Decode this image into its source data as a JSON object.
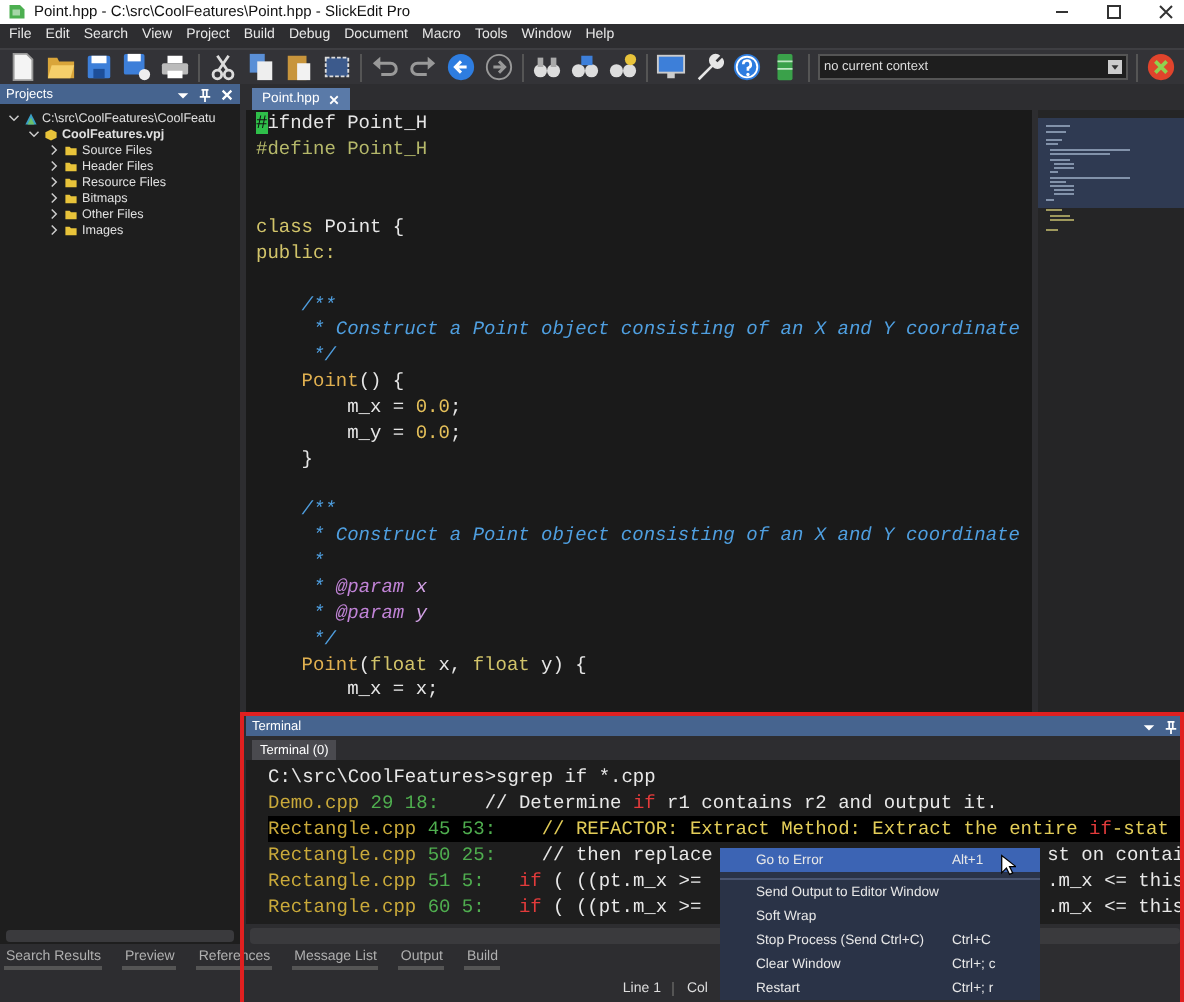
{
  "window": {
    "title": "Point.hpp - C:\\src\\CoolFeatures\\Point.hpp - SlickEdit Pro"
  },
  "menu": [
    "File",
    "Edit",
    "Search",
    "View",
    "Project",
    "Build",
    "Debug",
    "Document",
    "Macro",
    "Tools",
    "Window",
    "Help"
  ],
  "toolbar": {
    "context": {
      "value": "no current context"
    }
  },
  "projects": {
    "title": "Projects",
    "tree": [
      {
        "label": "C:\\src\\CoolFeatures\\CoolFeatu",
        "kind": "workspace",
        "expanded": true,
        "children": [
          {
            "label": "CoolFeatures.vpj",
            "kind": "project",
            "expanded": true,
            "children": [
              {
                "label": "Source Files",
                "kind": "folder",
                "expanded": false
              },
              {
                "label": "Header Files",
                "kind": "folder",
                "expanded": false
              },
              {
                "label": "Resource Files",
                "kind": "folder",
                "expanded": false
              },
              {
                "label": "Bitmaps",
                "kind": "folder",
                "expanded": false
              },
              {
                "label": "Other Files",
                "kind": "folder",
                "expanded": false
              },
              {
                "label": "Images",
                "kind": "folder",
                "expanded": false
              }
            ]
          }
        ]
      }
    ]
  },
  "editor": {
    "tabs": [
      {
        "label": "Point.hpp",
        "selected": true
      }
    ],
    "lines": [
      {
        "kind": "code",
        "segments": [
          {
            "text": "#",
            "kind": "cursor"
          },
          {
            "text": "ifndef Point_H",
            "kind": "plain"
          }
        ]
      },
      {
        "kind": "code",
        "segments": [
          {
            "text": "#define Point_H",
            "kind": "pre"
          }
        ]
      },
      {
        "kind": "blank"
      },
      {
        "kind": "blank"
      },
      {
        "kind": "code",
        "segments": [
          {
            "text": "class",
            "kind": "keyword"
          },
          {
            "text": " Point {",
            "kind": "plain"
          }
        ]
      },
      {
        "kind": "code",
        "segments": [
          {
            "text": "public:",
            "kind": "keyword"
          }
        ]
      },
      {
        "kind": "blank"
      },
      {
        "kind": "code",
        "segments": [
          {
            "text": "    /**",
            "kind": "comment"
          }
        ]
      },
      {
        "kind": "code",
        "segments": [
          {
            "text": "     * Construct a Point object consisting of an X and Y coordinate",
            "kind": "comment"
          }
        ]
      },
      {
        "kind": "code",
        "segments": [
          {
            "text": "     */",
            "kind": "comment"
          }
        ]
      },
      {
        "kind": "code",
        "segments": [
          {
            "text": "    Point",
            "kind": "func"
          },
          {
            "text": "() {",
            "kind": "plain"
          }
        ]
      },
      {
        "kind": "code",
        "segments": [
          {
            "text": "        m_x = ",
            "kind": "plain"
          },
          {
            "text": "0.0",
            "kind": "number"
          },
          {
            "text": ";",
            "kind": "plain"
          }
        ]
      },
      {
        "kind": "code",
        "segments": [
          {
            "text": "        m_y = ",
            "kind": "plain"
          },
          {
            "text": "0.0",
            "kind": "number"
          },
          {
            "text": ";",
            "kind": "plain"
          }
        ]
      },
      {
        "kind": "code",
        "segments": [
          {
            "text": "    }",
            "kind": "plain"
          }
        ]
      },
      {
        "kind": "blank"
      },
      {
        "kind": "code",
        "segments": [
          {
            "text": "    /**",
            "kind": "comment"
          }
        ]
      },
      {
        "kind": "code",
        "segments": [
          {
            "text": "     * Construct a Point object consisting of an X and Y coordinate",
            "kind": "comment"
          }
        ]
      },
      {
        "kind": "code",
        "segments": [
          {
            "text": "     *",
            "kind": "comment"
          }
        ]
      },
      {
        "kind": "code",
        "segments": [
          {
            "text": "     * ",
            "kind": "comment"
          },
          {
            "text": "@param",
            "kind": "doc"
          },
          {
            "text": " x",
            "kind": "docarg"
          }
        ]
      },
      {
        "kind": "code",
        "segments": [
          {
            "text": "     * ",
            "kind": "comment"
          },
          {
            "text": "@param",
            "kind": "doc"
          },
          {
            "text": " y",
            "kind": "docarg"
          }
        ]
      },
      {
        "kind": "code",
        "segments": [
          {
            "text": "     */",
            "kind": "comment"
          }
        ]
      },
      {
        "kind": "code",
        "segments": [
          {
            "text": "    Point",
            "kind": "func"
          },
          {
            "text": "(",
            "kind": "plain"
          },
          {
            "text": "float",
            "kind": "keyword"
          },
          {
            "text": " x, ",
            "kind": "plain"
          },
          {
            "text": "float",
            "kind": "keyword"
          },
          {
            "text": " y) {",
            "kind": "plain"
          }
        ]
      },
      {
        "kind": "code",
        "segments": [
          {
            "text": "        m_x = x;",
            "kind": "plain"
          }
        ]
      }
    ]
  },
  "terminal": {
    "title": "Terminal",
    "tabs": [
      {
        "label": "Terminal (0)",
        "selected": true
      }
    ],
    "lines": [
      {
        "selected": false,
        "segments": [
          {
            "text": "C:\\src\\CoolFeatures>sgrep if *.cpp",
            "kind": "plain"
          }
        ]
      },
      {
        "selected": false,
        "segments": [
          {
            "text": "Demo.cpp",
            "kind": "file"
          },
          {
            "text": " 29 18:",
            "kind": "number"
          },
          {
            "text": "    // Determine ",
            "kind": "plain"
          },
          {
            "text": "if",
            "kind": "match"
          },
          {
            "text": " r1 contains r2 and output it.",
            "kind": "plain"
          }
        ]
      },
      {
        "selected": true,
        "segments": [
          {
            "text": "Rectangle.cpp",
            "kind": "file"
          },
          {
            "text": " 45 53:",
            "kind": "number"
          },
          {
            "text": "    // REFACTOR: Extract Method: Extract the entire ",
            "kind": "plain"
          },
          {
            "text": "if",
            "kind": "match"
          },
          {
            "text": "-stat",
            "kind": "plain"
          }
        ]
      },
      {
        "selected": false,
        "segments": [
          {
            "text": "Rectangle.cpp",
            "kind": "file"
          },
          {
            "text": " 50 25:",
            "kind": "number"
          },
          {
            "text": "    // then replace ",
            "kind": "plain"
          }
        ],
        "tail": [
          {
            "text": "st on contai",
            "kind": "plain"
          }
        ]
      },
      {
        "selected": false,
        "segments": [
          {
            "text": "Rectangle.cpp",
            "kind": "file"
          },
          {
            "text": " 51 5:   ",
            "kind": "number"
          },
          {
            "text": "if",
            "kind": "match"
          },
          {
            "text": " ( ((pt.m_x >= ",
            "kind": "plain"
          }
        ],
        "tail": [
          {
            "text": ".m_x <= this",
            "kind": "plain"
          }
        ]
      },
      {
        "selected": false,
        "segments": [
          {
            "text": "Rectangle.cpp",
            "kind": "file"
          },
          {
            "text": " 60 5:   ",
            "kind": "number"
          },
          {
            "text": "if",
            "kind": "match"
          },
          {
            "text": " ( ((pt.m_x >= ",
            "kind": "plain"
          }
        ],
        "tail": [
          {
            "text": ".m_x <= this",
            "kind": "plain"
          }
        ]
      }
    ]
  },
  "bottom_tabs": [
    "Search Results",
    "Preview",
    "References",
    "Message List",
    "Output",
    "Build"
  ],
  "status_bar": {
    "line": "Line 1",
    "col": "Col"
  },
  "context_menu": [
    {
      "label": "Go to Error",
      "shortcut": "Alt+1",
      "selected": true,
      "separator_before": false
    },
    {
      "label": "Send Output to Editor Window",
      "selected": false,
      "separator_before": true
    },
    {
      "label": "Soft Wrap",
      "selected": false,
      "separator_before": false
    },
    {
      "label": "Stop Process (Send Ctrl+C)",
      "shortcut": "Ctrl+C",
      "selected": false,
      "separator_before": false
    },
    {
      "label": "Clear Window",
      "shortcut": "Ctrl+; c",
      "selected": false,
      "separator_before": false
    },
    {
      "label": "Restart",
      "shortcut": "Ctrl+; r",
      "selected": false,
      "separator_before": false
    }
  ]
}
